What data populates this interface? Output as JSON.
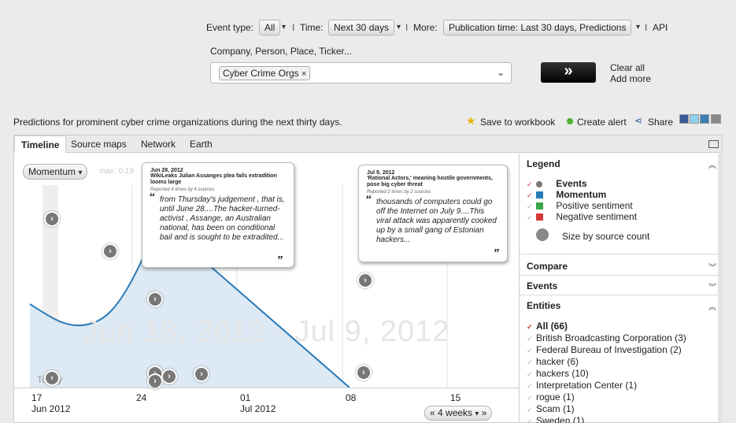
{
  "toolbar": {
    "event_type_label": "Event type:",
    "event_type_value": "All",
    "sep": "I",
    "time_label": "Time:",
    "time_value": "Next 30 days",
    "more_label": "More:",
    "more_value": "Publication time: Last 30 days, Predictions",
    "api_label": "API"
  },
  "search": {
    "label": "Company, Person, Place, Ticker...",
    "token": "Cyber Crime Orgs",
    "token_close": "×",
    "go_label": "»",
    "clear_all": "Clear all",
    "add_more": "Add more"
  },
  "description": "Predictions for prominent cyber crime organizations during the next thirty days.",
  "actions": {
    "save": "Save to workbook",
    "alert": "Create alert",
    "share": "Share"
  },
  "tabs": [
    "Timeline",
    "Source maps",
    "Network",
    "Earth"
  ],
  "timeline": {
    "momentum_label": "Momentum",
    "max_label": "max: 0.19",
    "watermark": "Jun 18, 2012 - Jul 9, 2012",
    "today": "Today",
    "ticks": [
      "17",
      "24",
      "01",
      "08",
      "15"
    ],
    "months": [
      "Jun 2012",
      "Jul 2012"
    ],
    "range_prev": "«",
    "range_value": "4 weeks",
    "range_next": "»",
    "momentum_curve": [
      {
        "day": "Jun 17",
        "value": 0.08
      },
      {
        "day": "Jun 20",
        "value": 0.06
      },
      {
        "day": "Jun 23",
        "value": 0.1
      },
      {
        "day": "Jun 26",
        "value": 0.19
      },
      {
        "day": "Jun 28",
        "value": 0.16
      },
      {
        "day": "Jul 03",
        "value": 0.09
      },
      {
        "day": "Jul 08",
        "value": 0.0
      }
    ],
    "bubbles": [
      {
        "date": "Jun 28, 2012",
        "title": "WikiLeaks Julian Assanges plea fails extradition looms large",
        "source": "Reported 4 times by 4 sources",
        "quote": "from Thursday's judgement , that is, until June 28....The hacker-turned-activist , Assange, an Australian national, has been on conditional bail and is sought to be extradited..."
      },
      {
        "date": "Jul 9, 2012",
        "title": "'Rational Actors,' meaning hostile governments, pose big cyber threat",
        "source": "Reported 2 times by 2 sources",
        "quote": "thousands of computers could go off the Internet on July 9....This viral attack was apparently cooked up by a small gang of Estonian hackers..."
      }
    ]
  },
  "sidebar": {
    "legend_title": "Legend",
    "legend_items": [
      {
        "label": "Events",
        "color": "#777777",
        "bold": true
      },
      {
        "label": "Momentum",
        "color": "#2a7ab8",
        "bold": true
      },
      {
        "label": "Positive sentiment",
        "color": "#3aa64a",
        "bold": false
      },
      {
        "label": "Negative sentiment",
        "color": "#d83a3a",
        "bold": false
      }
    ],
    "size_label": "Size by source count",
    "compare_title": "Compare",
    "events_title": "Events",
    "entities_title": "Entities",
    "entities": [
      {
        "label": "All (66)",
        "bold": true
      },
      {
        "label": "British Broadcasting Corporation (3)"
      },
      {
        "label": "Federal Bureau of Investigation (2)"
      },
      {
        "label": "hacker (6)"
      },
      {
        "label": "hackers (10)"
      },
      {
        "label": "Interpretation Center (1)"
      },
      {
        "label": "rogue (1)"
      },
      {
        "label": "Scam (1)"
      },
      {
        "label": "Sweden (1)"
      }
    ]
  }
}
